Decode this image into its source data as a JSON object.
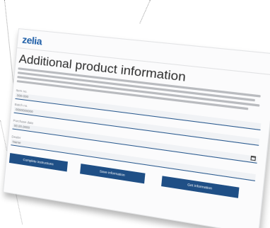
{
  "app": {
    "logo_text": "zelia"
  },
  "page": {
    "title": "Additional product information",
    "intro_lines": 4
  },
  "fields": [
    {
      "label": "Item no.",
      "value": "000-000"
    },
    {
      "label": "Batch no.",
      "value": "0000000000"
    },
    {
      "label": "Purchase date",
      "value": "00.00.0000"
    },
    {
      "label": "Dealer",
      "value": "Name"
    }
  ],
  "buttons": [
    {
      "label": "Complete instructions"
    },
    {
      "label": "Save information"
    },
    {
      "label": "Get information"
    }
  ],
  "colors": {
    "brand": "#1f5fa8",
    "button": "#1f4f86",
    "field_underline": "#2a5a8f"
  }
}
